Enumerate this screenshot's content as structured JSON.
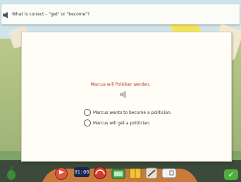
{
  "question": {
    "text": "What is correct – \"get\" or \"become\"?"
  },
  "exercise": {
    "prompt": "Marcus will Politiker werden.",
    "options": [
      {
        "label": "Marcus wants to become a politician."
      },
      {
        "label": "Marcus will get a politician."
      }
    ]
  },
  "toolbar": {
    "clock": "01:00"
  },
  "icons": {
    "question_speaker": "speaker-icon",
    "prompt_speaker": "speaker-icon",
    "check": "checkmark-icon"
  },
  "colors": {
    "prompt": "#b03a2e",
    "check_button": "#4fae3f"
  }
}
